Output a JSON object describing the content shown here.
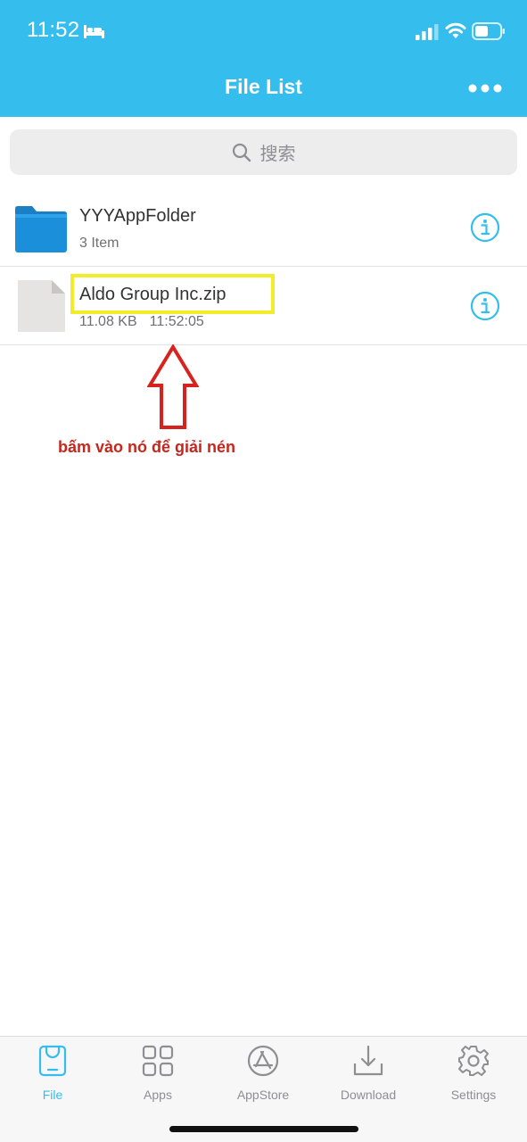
{
  "status_bar": {
    "time": "11:52"
  },
  "header": {
    "title": "File List",
    "background": "#35bdee"
  },
  "search": {
    "placeholder": "搜索"
  },
  "files": [
    {
      "name": "YYYAppFolder",
      "detail": "3 Item",
      "icon": "folder-icon"
    },
    {
      "name": "Aldo Group Inc.zip",
      "size": "11.08 KB",
      "time": "11:52:05",
      "icon": "file-icon"
    }
  ],
  "annotation": {
    "note": "bấm vào nó để giải nén",
    "highlight_color": "#f3ec2b",
    "arrow_color": "#c8261c"
  },
  "tabbar": {
    "active_color": "#35bdee",
    "tabs": [
      {
        "label": "File",
        "icon": "file-tab-icon",
        "active": true
      },
      {
        "label": "Apps",
        "icon": "apps-grid-icon"
      },
      {
        "label": "AppStore",
        "icon": "appstore-icon"
      },
      {
        "label": "Download",
        "icon": "download-icon"
      },
      {
        "label": "Settings",
        "icon": "gear-icon"
      }
    ]
  }
}
